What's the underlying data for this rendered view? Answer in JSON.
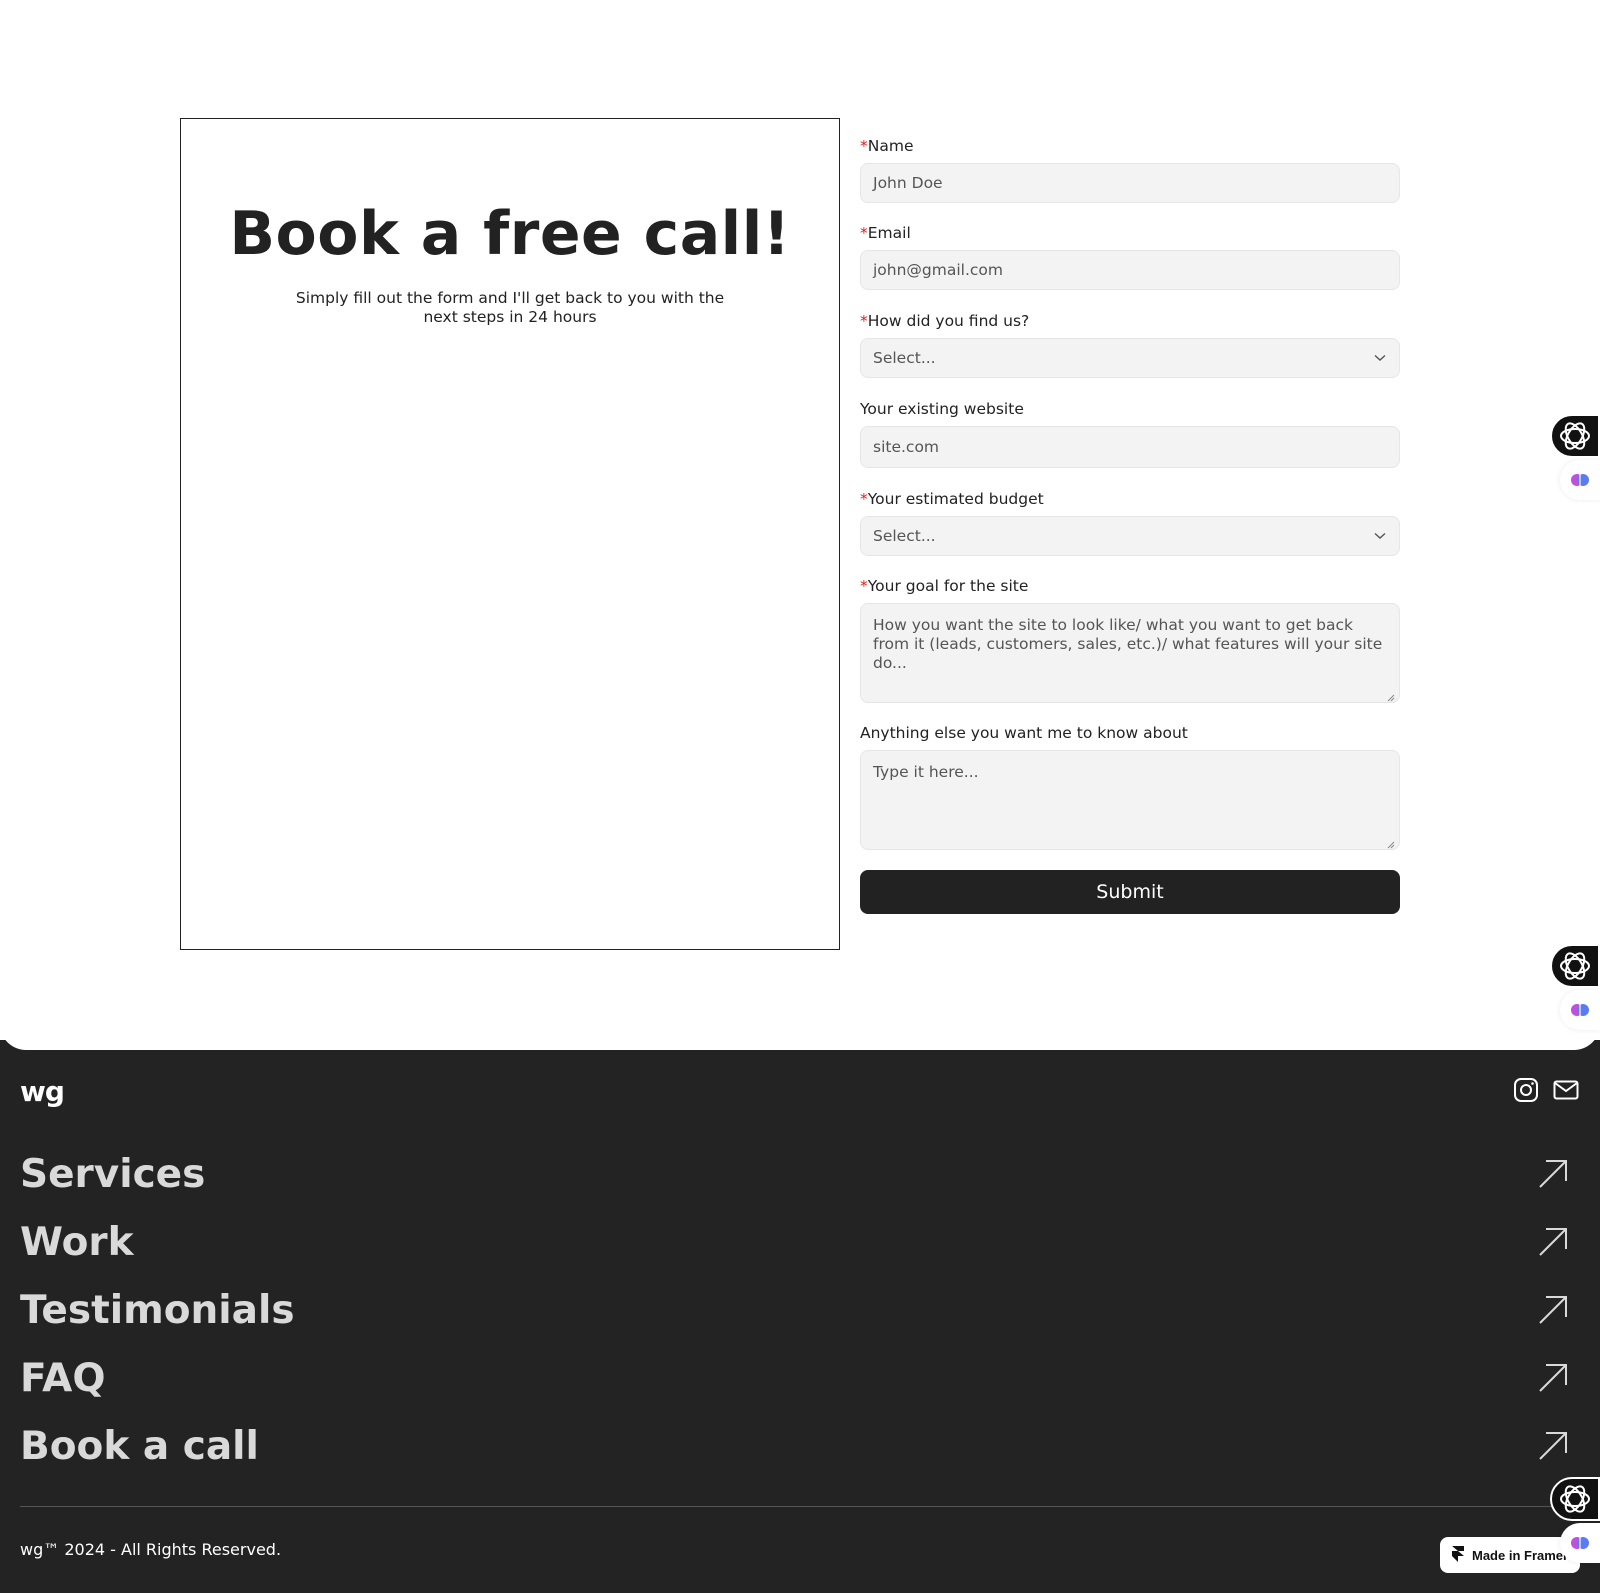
{
  "hero": {
    "title": "Book a free call!",
    "subtitle": "Simply fill out the form and I'll get back to you with the next steps in 24 hours"
  },
  "form": {
    "required_mark": "*",
    "name": {
      "label": "Name",
      "placeholder": "John Doe"
    },
    "email": {
      "label": "Email",
      "placeholder": "john@gmail.com"
    },
    "source": {
      "label": "How did you find us?",
      "value": "Select..."
    },
    "website": {
      "label": "Your existing website",
      "placeholder": "site.com"
    },
    "budget": {
      "label": "Your estimated budget",
      "value": "Select..."
    },
    "goal": {
      "label": "Your goal for the site",
      "placeholder": "How you want the site to look like/ what you want to get back from it (leads, customers, sales, etc.)/ what features will your site do..."
    },
    "other": {
      "label": "Anything else you want me to know about",
      "placeholder": "Type it here..."
    },
    "submit_label": "Submit"
  },
  "footer": {
    "logo": "wg",
    "nav": [
      "Services",
      "Work",
      "Testimonials",
      "FAQ",
      "Book a call"
    ],
    "copyright": "wg™ 2024 - All Rights Reserved.",
    "badge": "Made in Framer"
  },
  "icons": {
    "social": [
      "instagram-icon",
      "mail-icon"
    ],
    "nav_arrow": "arrow-up-right-icon",
    "select": "chevron-down-icon"
  },
  "colors": {
    "footer_bg": "#232323",
    "required": "#e02020",
    "button_bg": "#222222",
    "input_bg": "#f3f3f3"
  }
}
